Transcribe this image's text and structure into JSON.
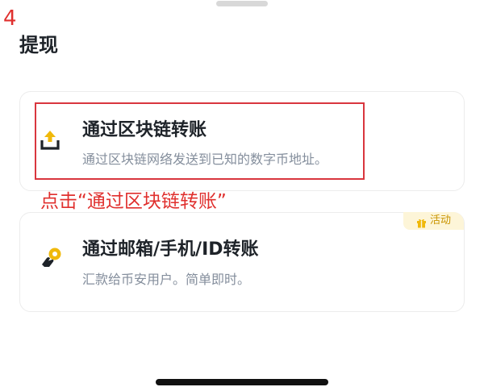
{
  "step": {
    "number": "4"
  },
  "header": {
    "title": "提现"
  },
  "options": [
    {
      "title": "通过区块链转账",
      "description": "通过区块链网络发送到已知的数字币地址。",
      "icon": "upload-tray-icon"
    },
    {
      "title": "通过邮箱/手机/ID转账",
      "description": "汇款给币安用户。简单即时。",
      "icon": "hand-coin-icon",
      "badge": {
        "label": "活动",
        "icon": "gift-icon"
      }
    }
  ],
  "annotation": {
    "text": "点击“通过区块链转账”"
  },
  "colors": {
    "annotation_red": "#e0302e",
    "title_text": "#1e2329",
    "description_text": "#848e9c",
    "accent_yellow": "#f0b90b",
    "badge_bg": "#fdf5d8",
    "badge_text": "#c99400"
  }
}
